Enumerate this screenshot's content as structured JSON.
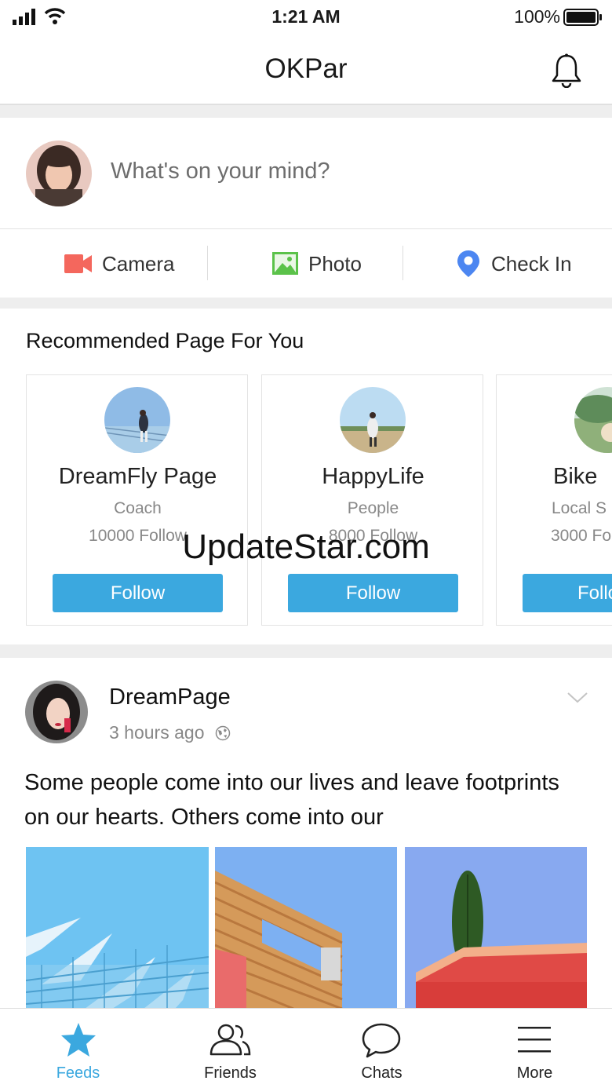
{
  "status_bar": {
    "time": "1:21 AM",
    "battery": "100%"
  },
  "header": {
    "title": "OKPar"
  },
  "composer": {
    "placeholder": "What's on your mind?"
  },
  "quick_actions": {
    "camera": "Camera",
    "photo": "Photo",
    "check_in": "Check In"
  },
  "recommended": {
    "heading": "Recommended Page For You",
    "pages": [
      {
        "name": "DreamFly Page",
        "category": "Coach",
        "followers": "10000 Follow",
        "button": "Follow"
      },
      {
        "name": "HappyLife",
        "category": "People",
        "followers": "8000 Follow",
        "button": "Follow"
      },
      {
        "name": "Bike",
        "category": "Local S",
        "followers": "3000 Fo",
        "button": "Follo"
      }
    ]
  },
  "watermark": "UpdateStar.com",
  "post": {
    "author": "DreamPage",
    "time": "3 hours ago",
    "text": "Some people come into our lives and leave footprints on our hearts. Others come into our"
  },
  "tab_bar": {
    "feeds": "Feeds",
    "friends": "Friends",
    "chats": "Chats",
    "more": "More"
  },
  "colors": {
    "accent": "#3ba8df",
    "camera": "#f4675d",
    "photo": "#5bc24a",
    "check_in": "#4c86f1"
  }
}
